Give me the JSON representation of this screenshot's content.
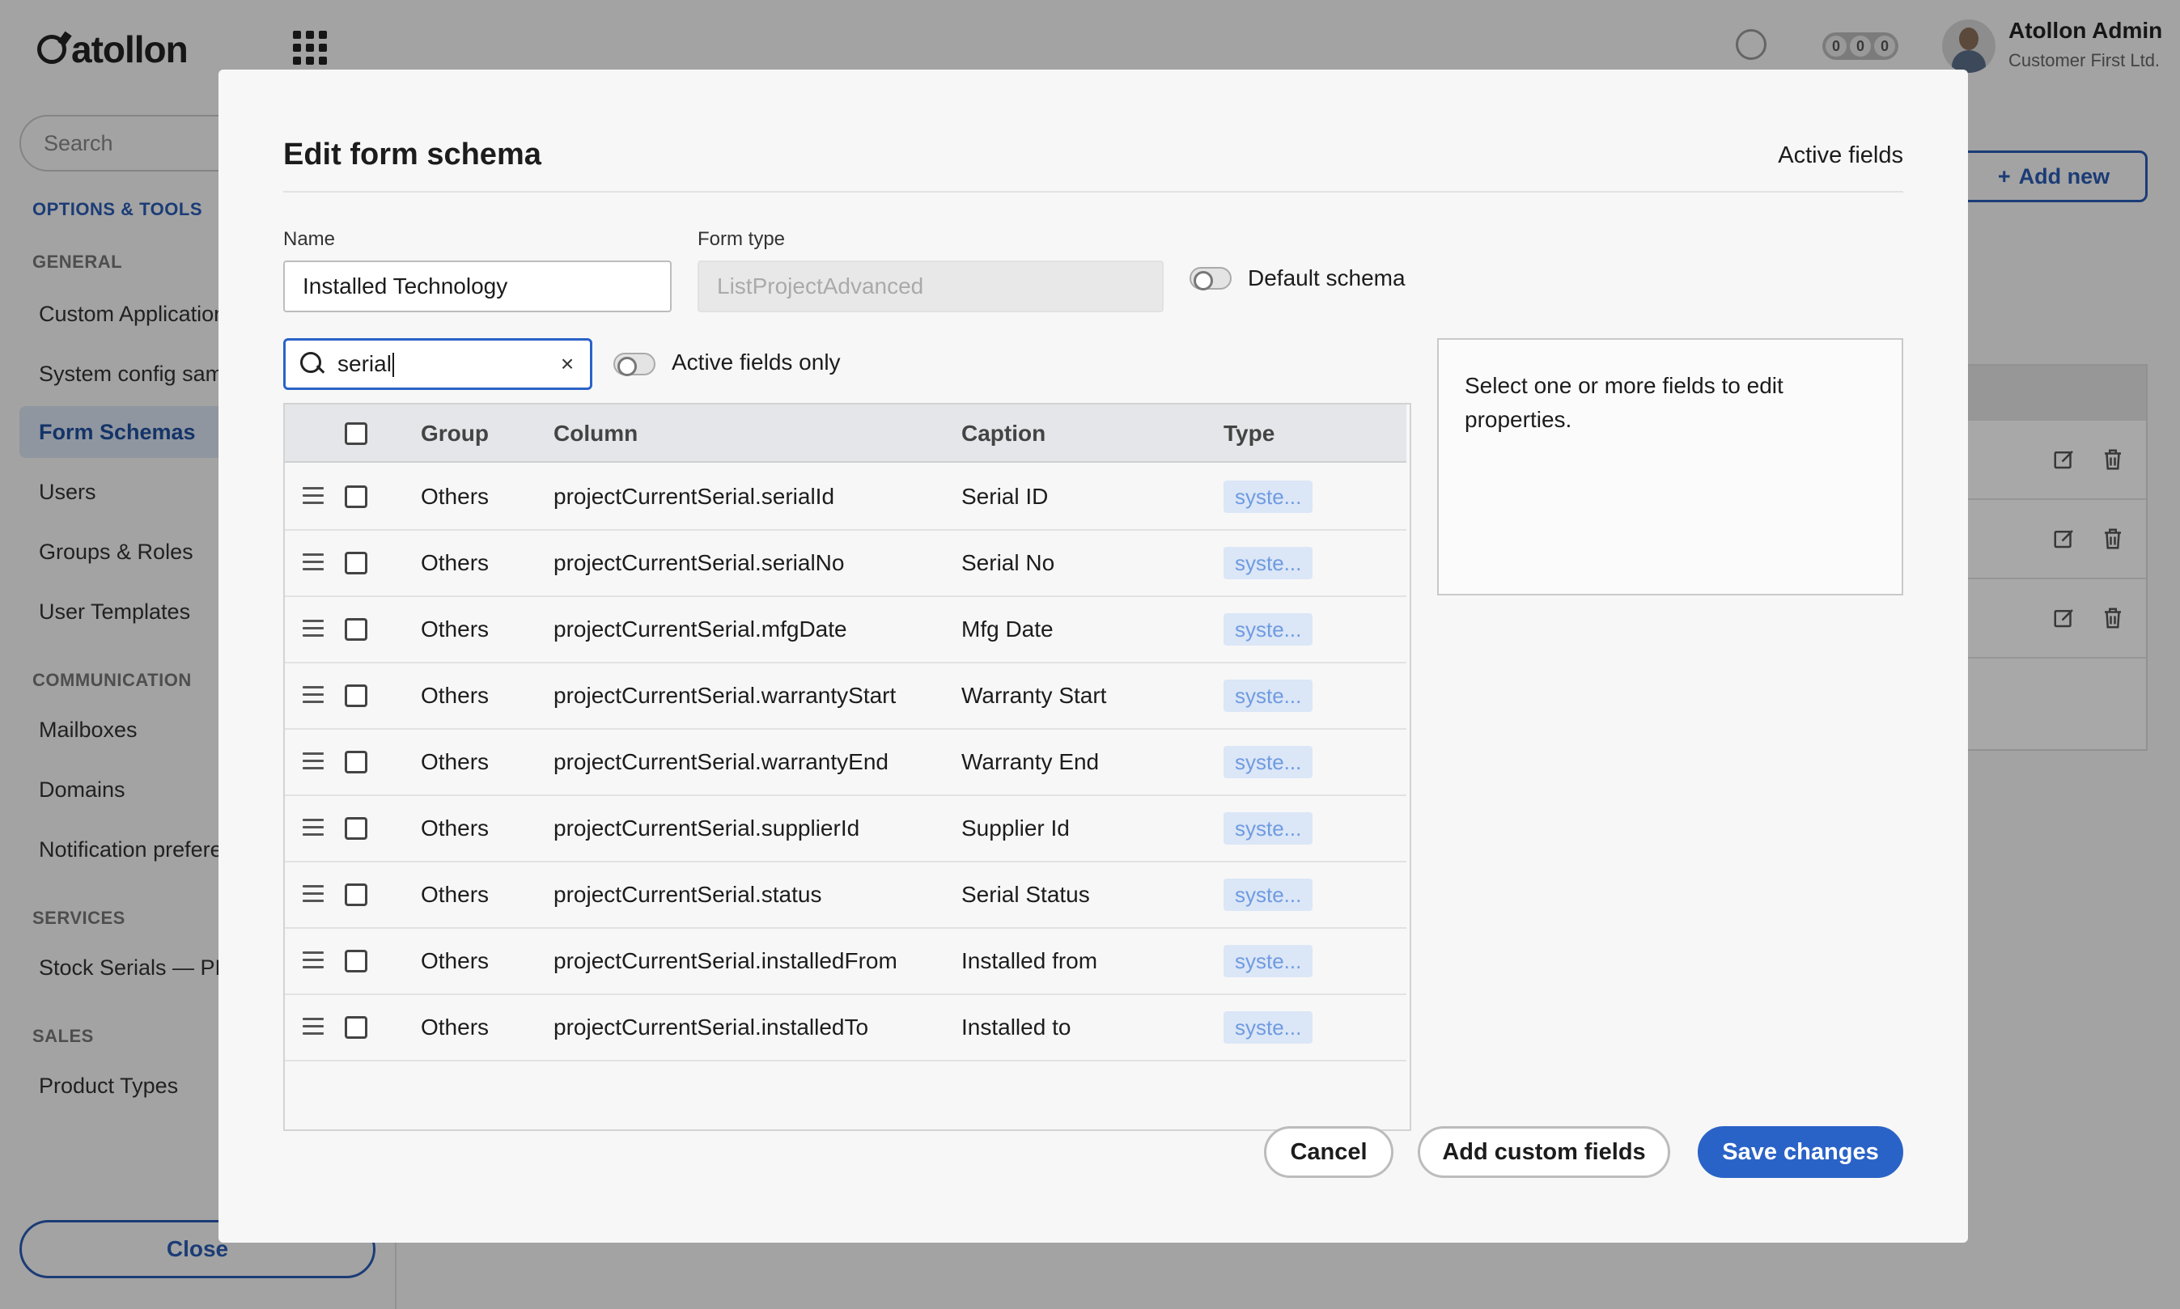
{
  "app": {
    "logo_text": "atollon",
    "user": {
      "name": "Atollon Admin",
      "org": "Customer First Ltd."
    },
    "counters": [
      "0",
      "0",
      "0"
    ],
    "sidebar": {
      "search_placeholder": "Search",
      "heading": "OPTIONS & TOOLS",
      "sections": {
        "general": "GENERAL",
        "communication": "COMMUNICATION",
        "services": "SERVICES",
        "sales": "SALES"
      },
      "items": {
        "custom_applications": "Custom Applications",
        "system_config": "System config samples",
        "form_schemas": "Form Schemas",
        "users": "Users",
        "groups_roles": "Groups & Roles",
        "user_templates": "User Templates",
        "mailboxes": "Mailboxes",
        "domains": "Domains",
        "notification_prefs": "Notification preferences",
        "stock_serials": "Stock Serials — PM",
        "product_types": "Product Types"
      },
      "close_label": "Close"
    },
    "add_new_label": "Add new"
  },
  "modal": {
    "title": "Edit form schema",
    "active_fields_link": "Active fields",
    "name_label": "Name",
    "name_value": "Installed Technology",
    "form_type_label": "Form type",
    "form_type_value": "ListProjectAdvanced",
    "default_schema_label": "Default schema",
    "search_value": "serial",
    "active_only_label": "Active fields only",
    "columns": {
      "group": "Group",
      "column": "Column",
      "caption": "Caption",
      "type": "Type"
    },
    "rows": [
      {
        "group": "Others",
        "column": "projectCurrentSerial.serialId",
        "caption": "Serial ID",
        "type": "syste..."
      },
      {
        "group": "Others",
        "column": "projectCurrentSerial.serialNo",
        "caption": "Serial No",
        "type": "syste..."
      },
      {
        "group": "Others",
        "column": "projectCurrentSerial.mfgDate",
        "caption": "Mfg Date",
        "type": "syste..."
      },
      {
        "group": "Others",
        "column": "projectCurrentSerial.warrantyStart",
        "caption": "Warranty Start",
        "type": "syste..."
      },
      {
        "group": "Others",
        "column": "projectCurrentSerial.warrantyEnd",
        "caption": "Warranty End",
        "type": "syste..."
      },
      {
        "group": "Others",
        "column": "projectCurrentSerial.supplierId",
        "caption": "Supplier Id",
        "type": "syste..."
      },
      {
        "group": "Others",
        "column": "projectCurrentSerial.status",
        "caption": "Serial Status",
        "type": "syste..."
      },
      {
        "group": "Others",
        "column": "projectCurrentSerial.installedFrom",
        "caption": "Installed from",
        "type": "syste..."
      },
      {
        "group": "Others",
        "column": "projectCurrentSerial.installedTo",
        "caption": "Installed to",
        "type": "syste..."
      }
    ],
    "props_hint": "Select one or more fields to edit properties.",
    "buttons": {
      "cancel": "Cancel",
      "add_custom": "Add custom fields",
      "save": "Save changes"
    }
  },
  "colors": {
    "accent": "#2a63c7",
    "badge_bg": "#dbe6f7",
    "badge_text": "#6f9be0"
  }
}
